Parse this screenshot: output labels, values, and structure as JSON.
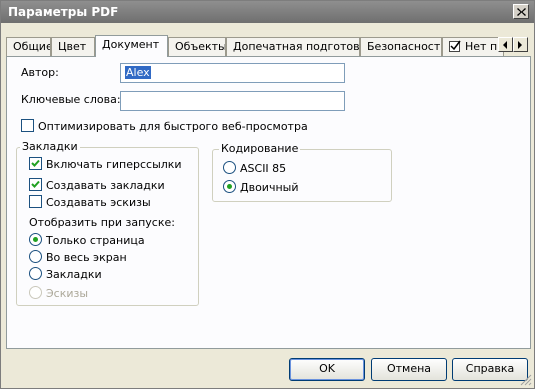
{
  "window": {
    "title": "Параметры PDF"
  },
  "tabs": [
    {
      "label": "Общие"
    },
    {
      "label": "Цвет"
    },
    {
      "label": "Документ"
    },
    {
      "label": "Объекты"
    },
    {
      "label": "Допечатная подготовка"
    },
    {
      "label": "Безопасность"
    },
    {
      "label": "Нет п"
    }
  ],
  "fields": {
    "author_label": "Автор:",
    "author_value": "Alex",
    "keywords_label": "Ключевые слова:",
    "keywords_value": ""
  },
  "optimize": {
    "label": "Оптимизировать для быстрого веб-просмотра",
    "checked": false
  },
  "bookmarks_group": {
    "title": "Закладки",
    "hyperlinks": {
      "label": "Включать гиперссылки",
      "checked": true
    },
    "create_bookmarks": {
      "label": "Создавать закладки",
      "checked": true
    },
    "create_thumbnails": {
      "label": "Создавать эскизы",
      "checked": false
    },
    "startup_label": "Отобразить при запуске:",
    "startup_options": [
      {
        "label": "Только страница",
        "selected": true,
        "enabled": true
      },
      {
        "label": "Во весь экран",
        "selected": false,
        "enabled": true
      },
      {
        "label": "Закладки",
        "selected": false,
        "enabled": true
      },
      {
        "label": "Эскизы",
        "selected": false,
        "enabled": false
      }
    ]
  },
  "encoding_group": {
    "title": "Кодирование",
    "options": [
      {
        "label": "ASCII 85",
        "selected": false
      },
      {
        "label": "Двоичный",
        "selected": true
      }
    ]
  },
  "buttons": {
    "ok": "OK",
    "cancel": "Отмена",
    "help": "Справка"
  },
  "colors": {
    "titlebar": "#7f7f7f",
    "face": "#ece9d8",
    "radio_dot": "#21a121",
    "selection": "#316ac5"
  },
  "icons": {
    "close": "close-icon",
    "tab_scroll_left": "chevron-left-icon",
    "tab_scroll_right": "chevron-right-icon",
    "tab_extra": "checkbox-doc-icon"
  }
}
